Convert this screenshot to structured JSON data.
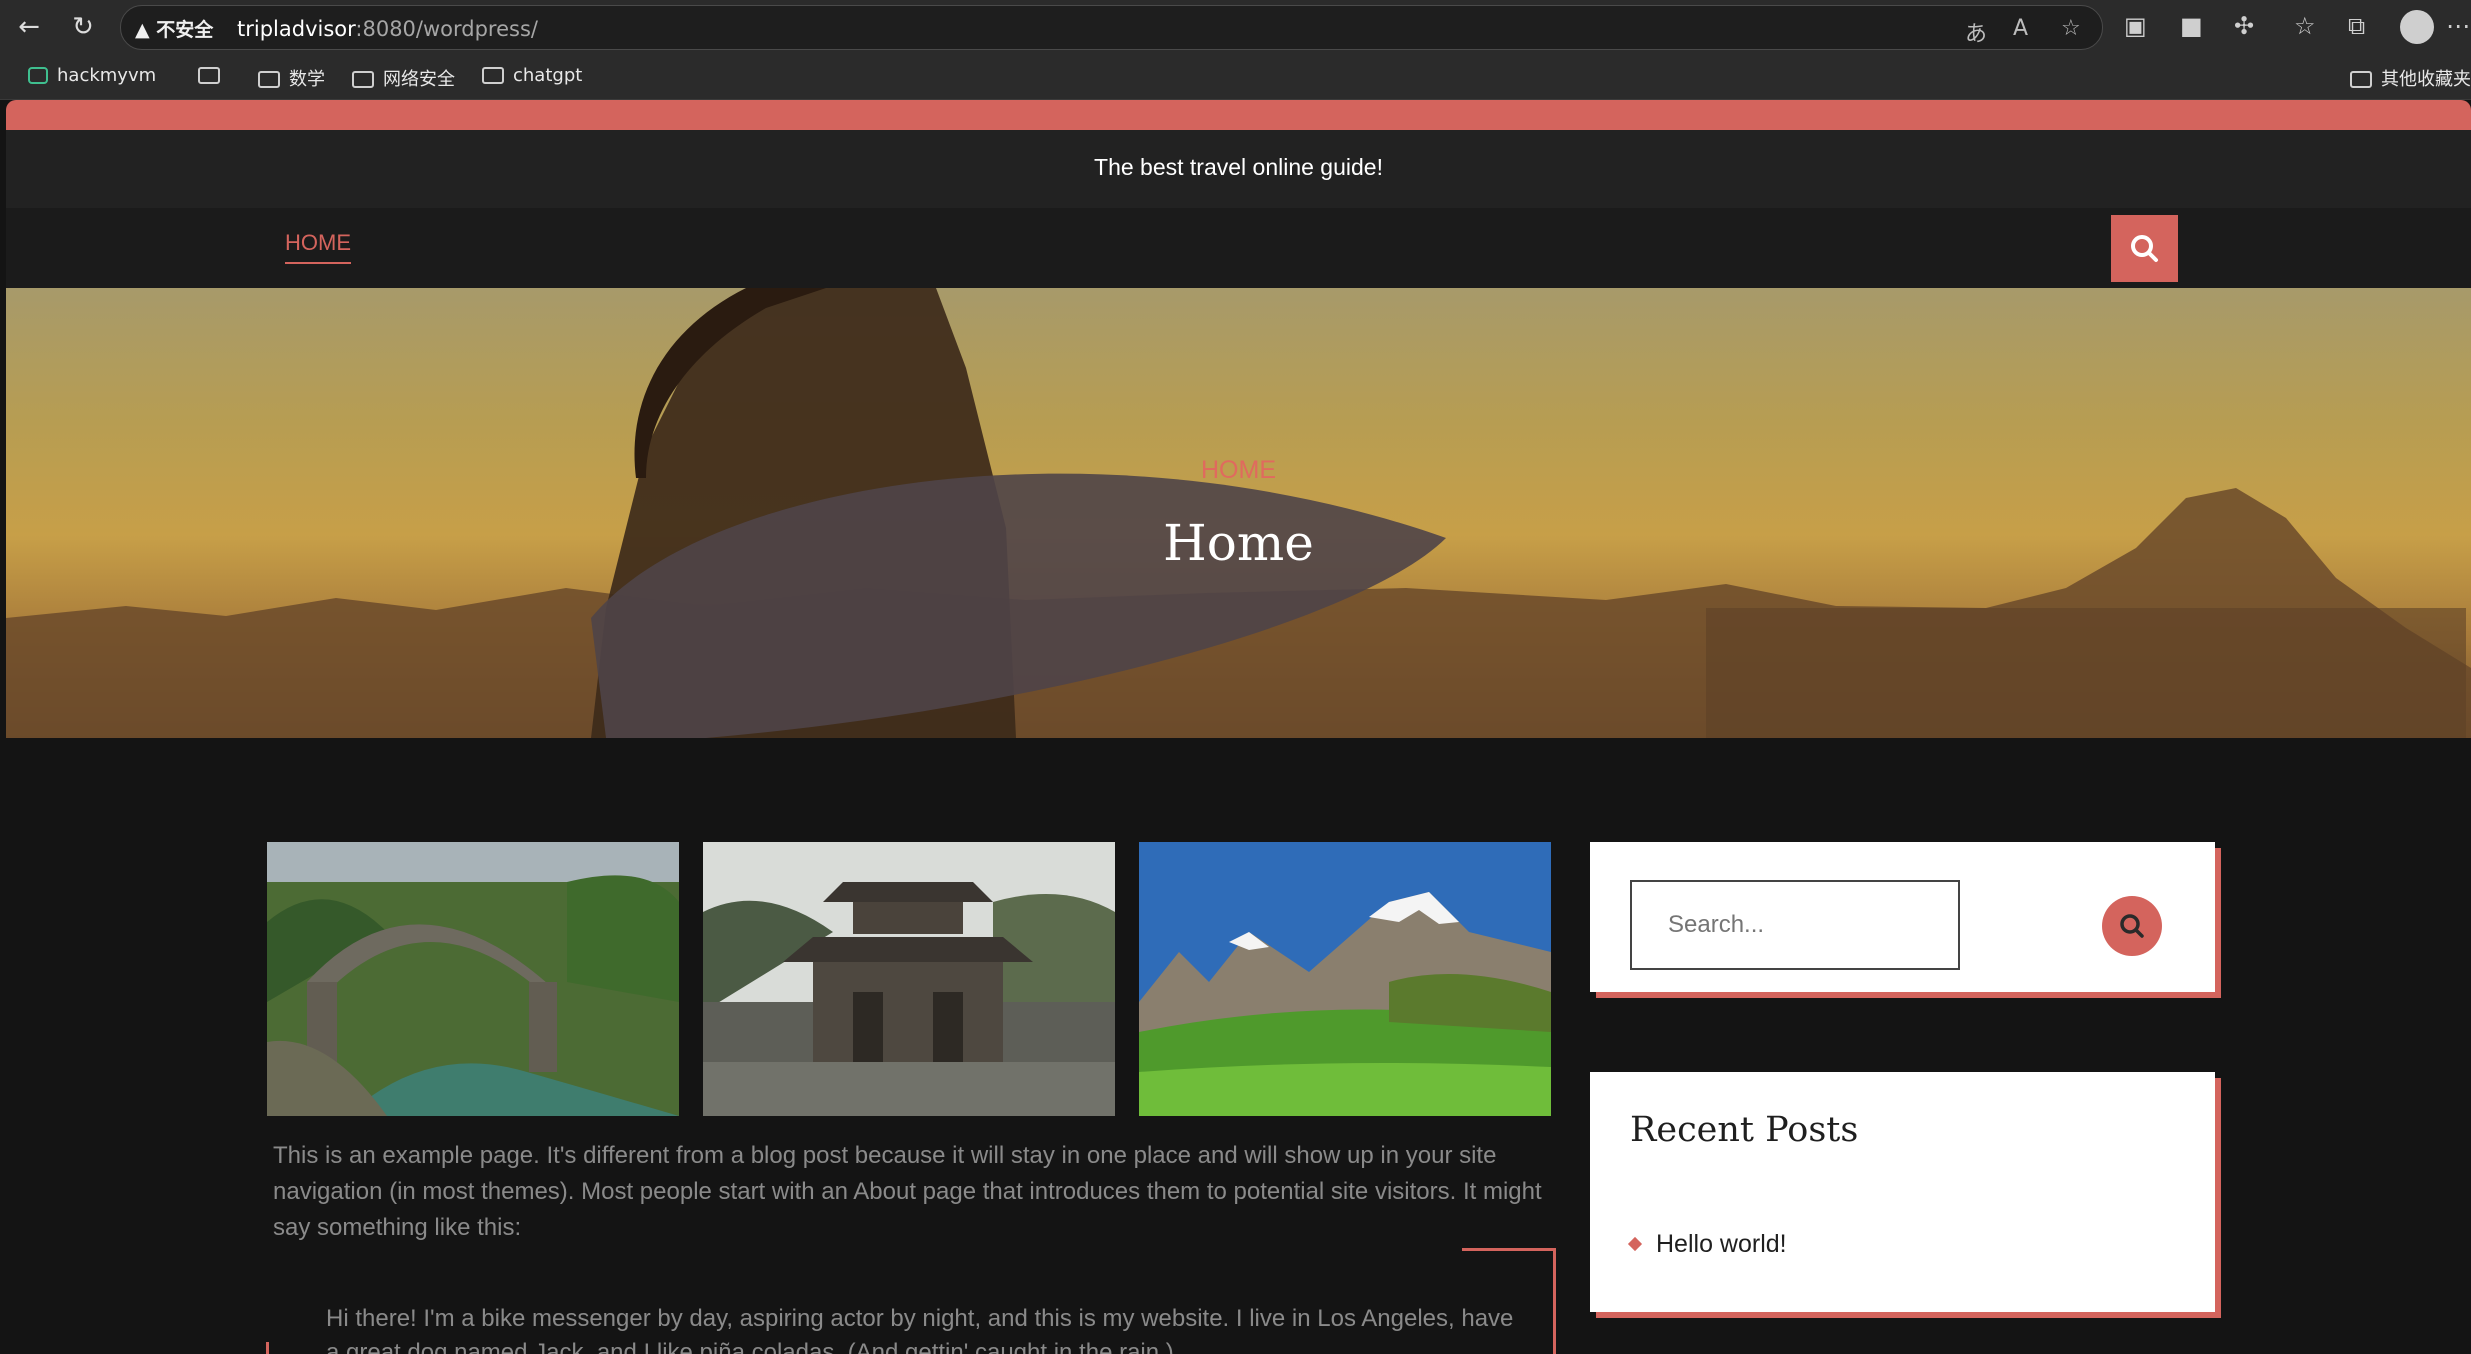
{
  "browser": {
    "security_label": "不安全",
    "url_host": "tripladvisor",
    "url_rest": ":8080/wordpress/"
  },
  "bookmarks": {
    "items": [
      "hackmyvm",
      "数学",
      "网络安全",
      "chatgpt"
    ],
    "other": "其他收藏夹"
  },
  "site": {
    "tagline": "The best travel online guide!",
    "menu_home": "HOME",
    "accent_color": "#d4645d"
  },
  "hero": {
    "breadcrumb": "HOME",
    "title": "Home"
  },
  "content": {
    "paragraph": "This is an example page. It's different from a blog post because it will stay in one place and will show up in your site navigation (in most themes). Most people start with an About page that introduces them to potential site visitors. It might say something like this:",
    "quote": "Hi there! I'm a bike messenger by day, aspiring actor by night, and this is my website. I live in Los Angeles, have a great dog named Jack, and I like piña coladas. (And gettin' caught in the rain.)"
  },
  "sidebar": {
    "search_placeholder": "Search...",
    "recent_title": "Recent Posts",
    "recent_posts": [
      "Hello world!"
    ]
  }
}
